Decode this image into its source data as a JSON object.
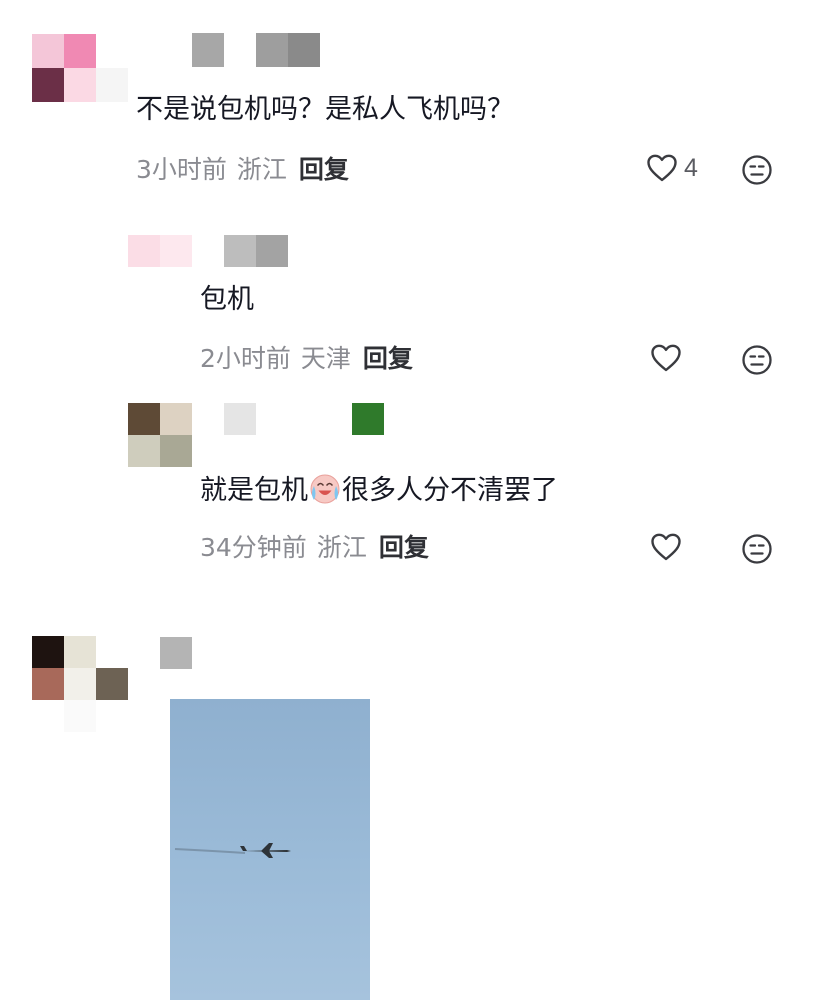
{
  "colors": {
    "text_primary": "#161823",
    "text_meta": "#8a8b91",
    "reply": "#2f3035",
    "sky": "#9bbbd8"
  },
  "comments": [
    {
      "text": "不是说包机吗？是私人飞机吗？",
      "time": "3小时前",
      "location": "浙江",
      "reply_label": "回复",
      "likes": "4",
      "like_icon": "heart-outline-icon",
      "dislike_icon": "meh-face-icon"
    },
    {
      "text": "包机",
      "time": "2小时前",
      "location": "天津",
      "reply_label": "回复",
      "like_icon": "heart-outline-icon",
      "dislike_icon": "meh-face-icon"
    },
    {
      "text_before": "就是包机",
      "emoji": "crying-laughing-emoji",
      "text_after": "很多人分不清罢了",
      "time": "34分钟前",
      "location": "浙江",
      "reply_label": "回复",
      "like_icon": "heart-outline-icon",
      "dislike_icon": "meh-face-icon"
    }
  ],
  "image_comment": {
    "image": "sky-airplane-photo"
  }
}
